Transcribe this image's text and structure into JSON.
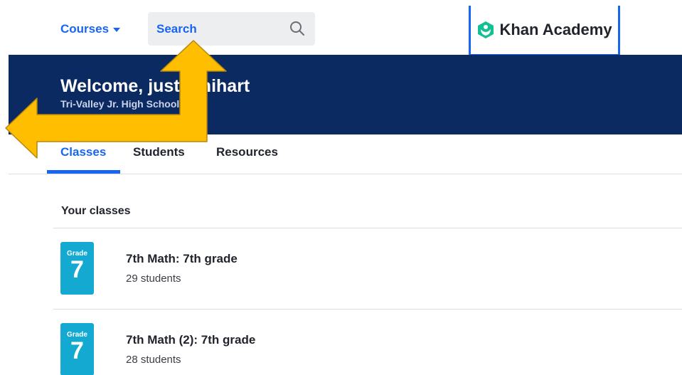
{
  "nav": {
    "courses_label": "Courses",
    "search_label": "Search",
    "logo_text": "Khan Academy"
  },
  "banner": {
    "welcome_text": "Welcome, justin.hihart",
    "school_text": "Tri-Valley Jr. High School 103"
  },
  "tabs": [
    {
      "label": "Classes",
      "active": true
    },
    {
      "label": "Students",
      "active": false
    },
    {
      "label": "Resources",
      "active": false
    }
  ],
  "classes": {
    "section_title": "Your classes",
    "items": [
      {
        "grade_label": "Grade",
        "grade_number": "7",
        "name": "7th Math: 7th grade",
        "students": "29 students"
      },
      {
        "grade_label": "Grade",
        "grade_number": "7",
        "name": "7th Math (2): 7th grade",
        "students": "28 students"
      }
    ]
  },
  "colors": {
    "accent": "#1865f2",
    "banner": "#0b2a62",
    "grade_tile": "#14a9d1",
    "logo_green": "#14bf96",
    "arrow_fill": "#ffbe00",
    "arrow_stroke": "#b8860b"
  }
}
